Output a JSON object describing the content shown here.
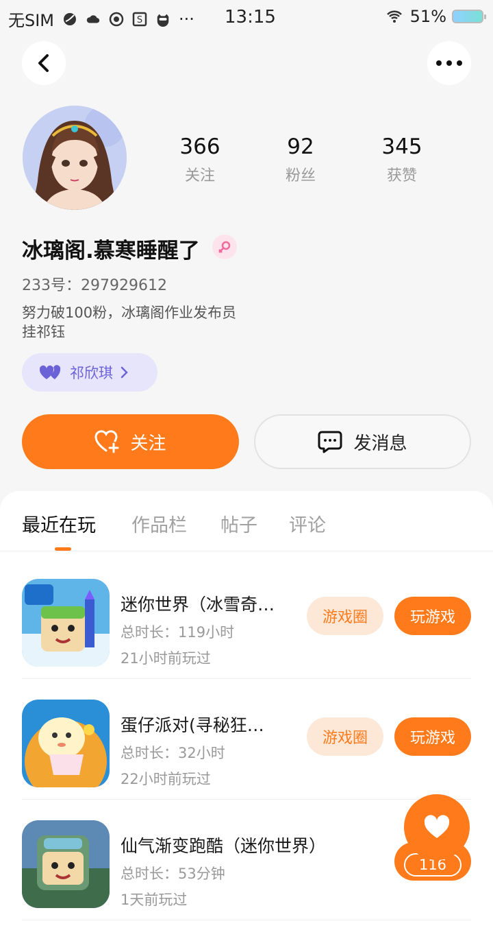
{
  "status_bar": {
    "carrier": "无SIM",
    "time": "13:15",
    "battery": "51%"
  },
  "profile": {
    "nickname": "冰璃阁.慕寒睡醒了",
    "uid_label": "233号：297929612",
    "bio_line1": "努力破100粉，冰璃阁作业发布员",
    "bio_line2": "挂祁钰",
    "tag_name": "祁欣琪",
    "stats": [
      {
        "value": "366",
        "label": "关注"
      },
      {
        "value": "92",
        "label": "粉丝"
      },
      {
        "value": "345",
        "label": "获赞"
      }
    ]
  },
  "actions": {
    "follow_label": "关注",
    "message_label": "发消息"
  },
  "tabs": [
    {
      "label": "最近在玩",
      "active": true
    },
    {
      "label": "作品栏",
      "active": false
    },
    {
      "label": "帖子",
      "active": false
    },
    {
      "label": "评论",
      "active": false
    }
  ],
  "games": [
    {
      "name": "迷你世界（冰雪奇…",
      "duration": "总时长：119小时",
      "last_played": "21小时前玩过",
      "circle_label": "游戏圈",
      "play_label": "玩游戏"
    },
    {
      "name": "蛋仔派对(寻秘狂…",
      "duration": "总时长：32小时",
      "last_played": "22小时前玩过",
      "circle_label": "游戏圈",
      "play_label": "玩游戏"
    },
    {
      "name": "仙气渐变跑酷（迷你世界）",
      "duration": "总时长：53分钟",
      "last_played": "1天前玩过"
    }
  ],
  "like_fab": {
    "count": "116"
  },
  "colors": {
    "accent": "#ff7a1a",
    "tag_bg": "#e6e5fb",
    "tag_text": "#6c62d8"
  }
}
